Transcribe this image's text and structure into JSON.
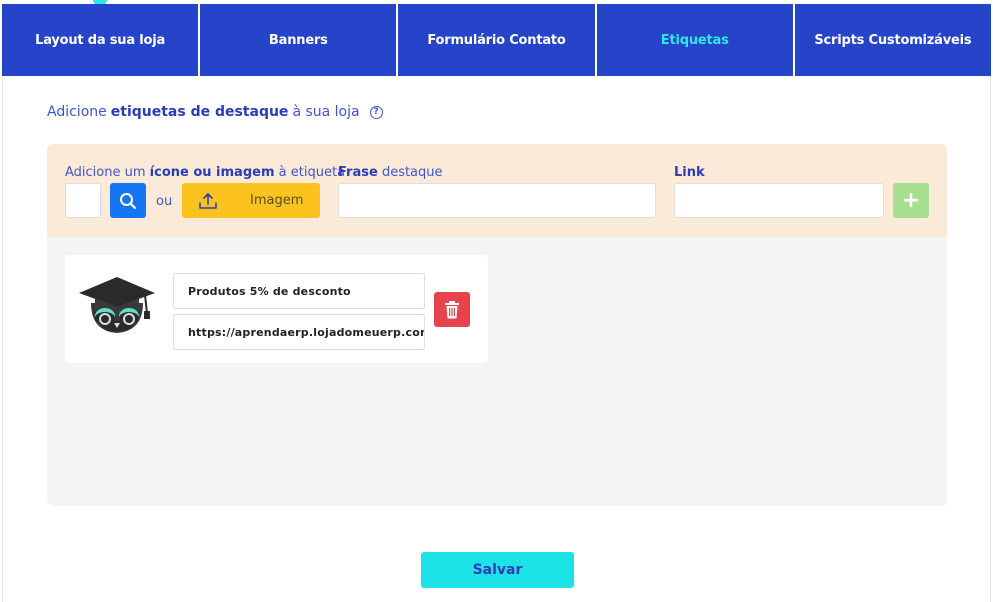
{
  "tabs": [
    {
      "label": "Layout da sua loja",
      "active": false
    },
    {
      "label": "Banners",
      "active": false
    },
    {
      "label": "Formulário Contato",
      "active": false
    },
    {
      "label": "Etiquetas",
      "active": true
    },
    {
      "label": "Scripts Customizáveis",
      "active": false
    }
  ],
  "intro": {
    "prefix": "Adicione",
    "bold": "etiquetas de destaque",
    "suffix": "à sua loja",
    "help_glyph": "?"
  },
  "form": {
    "icon_label_prefix": "Adicione um",
    "icon_label_bold": "ícone ou imagem",
    "icon_label_suffix": "à etiqueta",
    "or_text": "ou",
    "image_button_label": "Imagem",
    "phrase_label_bold": "Frase",
    "phrase_label_suffix": "destaque",
    "link_label": "Link",
    "add_button_glyph": "+"
  },
  "tags": [
    {
      "icon": "graduation-owl-icon",
      "phrase": "Produtos 5% de desconto",
      "link": "https://aprendaerp.lojadomeuerp.com.br"
    }
  ],
  "save_button_label": "Salvar",
  "colors": {
    "tab_bg": "#2544c9",
    "tab_active_text": "#2ee6ee",
    "form_row_bg": "#fbead7",
    "search_button": "#1675f2",
    "image_button": "#fcc21e",
    "add_button": "#a6df8f",
    "delete_button": "#e8424d",
    "save_button": "#1de3e8"
  }
}
